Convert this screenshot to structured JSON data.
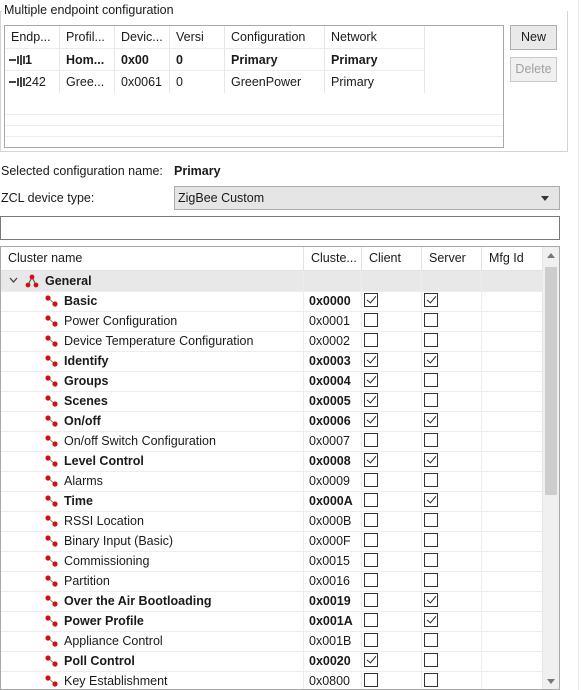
{
  "group_title": "Multiple endpoint configuration",
  "endpoint_table": {
    "headers": [
      "Endp...",
      "Profil...",
      "Devic...",
      "Versi",
      "Configuration",
      "Network"
    ],
    "rows": [
      {
        "icon": "endpoint-primary-icon",
        "cells": [
          "1",
          "Hom...",
          "0x00",
          "0",
          "Primary",
          "Primary"
        ],
        "bold": true
      },
      {
        "icon": "endpoint-greenpower-icon",
        "cells": [
          "242",
          "Gree...",
          "0x0061",
          "0",
          "GreenPower",
          "Primary"
        ],
        "bold": false
      }
    ]
  },
  "buttons": {
    "new": "New",
    "delete": "Delete"
  },
  "selected_config": {
    "label": "Selected configuration name:",
    "value": "Primary"
  },
  "device_type": {
    "label": "ZCL device type:",
    "value": "ZigBee Custom"
  },
  "filter": {
    "value": ""
  },
  "cluster_table": {
    "headers": [
      "Cluster name",
      "Cluste...",
      "Client",
      "Server",
      "Mfg Id"
    ],
    "group": "General",
    "rows": [
      {
        "name": "Basic",
        "id": "0x0000",
        "client": true,
        "server": true,
        "bold": true
      },
      {
        "name": "Power Configuration",
        "id": "0x0001",
        "client": false,
        "server": false,
        "bold": false
      },
      {
        "name": "Device Temperature Configuration",
        "id": "0x0002",
        "client": false,
        "server": false,
        "bold": false
      },
      {
        "name": "Identify",
        "id": "0x0003",
        "client": true,
        "server": true,
        "bold": true
      },
      {
        "name": "Groups",
        "id": "0x0004",
        "client": true,
        "server": false,
        "bold": true
      },
      {
        "name": "Scenes",
        "id": "0x0005",
        "client": true,
        "server": false,
        "bold": true
      },
      {
        "name": "On/off",
        "id": "0x0006",
        "client": true,
        "server": true,
        "bold": true
      },
      {
        "name": "On/off Switch Configuration",
        "id": "0x0007",
        "client": false,
        "server": false,
        "bold": false
      },
      {
        "name": "Level Control",
        "id": "0x0008",
        "client": true,
        "server": true,
        "bold": true
      },
      {
        "name": "Alarms",
        "id": "0x0009",
        "client": false,
        "server": false,
        "bold": false
      },
      {
        "name": "Time",
        "id": "0x000A",
        "client": false,
        "server": true,
        "bold": true
      },
      {
        "name": "RSSI Location",
        "id": "0x000B",
        "client": false,
        "server": false,
        "bold": false
      },
      {
        "name": "Binary Input (Basic)",
        "id": "0x000F",
        "client": false,
        "server": false,
        "bold": false
      },
      {
        "name": "Commissioning",
        "id": "0x0015",
        "client": false,
        "server": false,
        "bold": false
      },
      {
        "name": "Partition",
        "id": "0x0016",
        "client": false,
        "server": false,
        "bold": false
      },
      {
        "name": "Over the Air Bootloading",
        "id": "0x0019",
        "client": false,
        "server": true,
        "bold": true
      },
      {
        "name": "Power Profile",
        "id": "0x001A",
        "client": false,
        "server": true,
        "bold": true
      },
      {
        "name": "Appliance Control",
        "id": "0x001B",
        "client": false,
        "server": false,
        "bold": false
      },
      {
        "name": "Poll Control",
        "id": "0x0020",
        "client": true,
        "server": false,
        "bold": true
      },
      {
        "name": "Key Establishment",
        "id": "0x0800",
        "client": false,
        "server": false,
        "bold": false
      }
    ]
  }
}
